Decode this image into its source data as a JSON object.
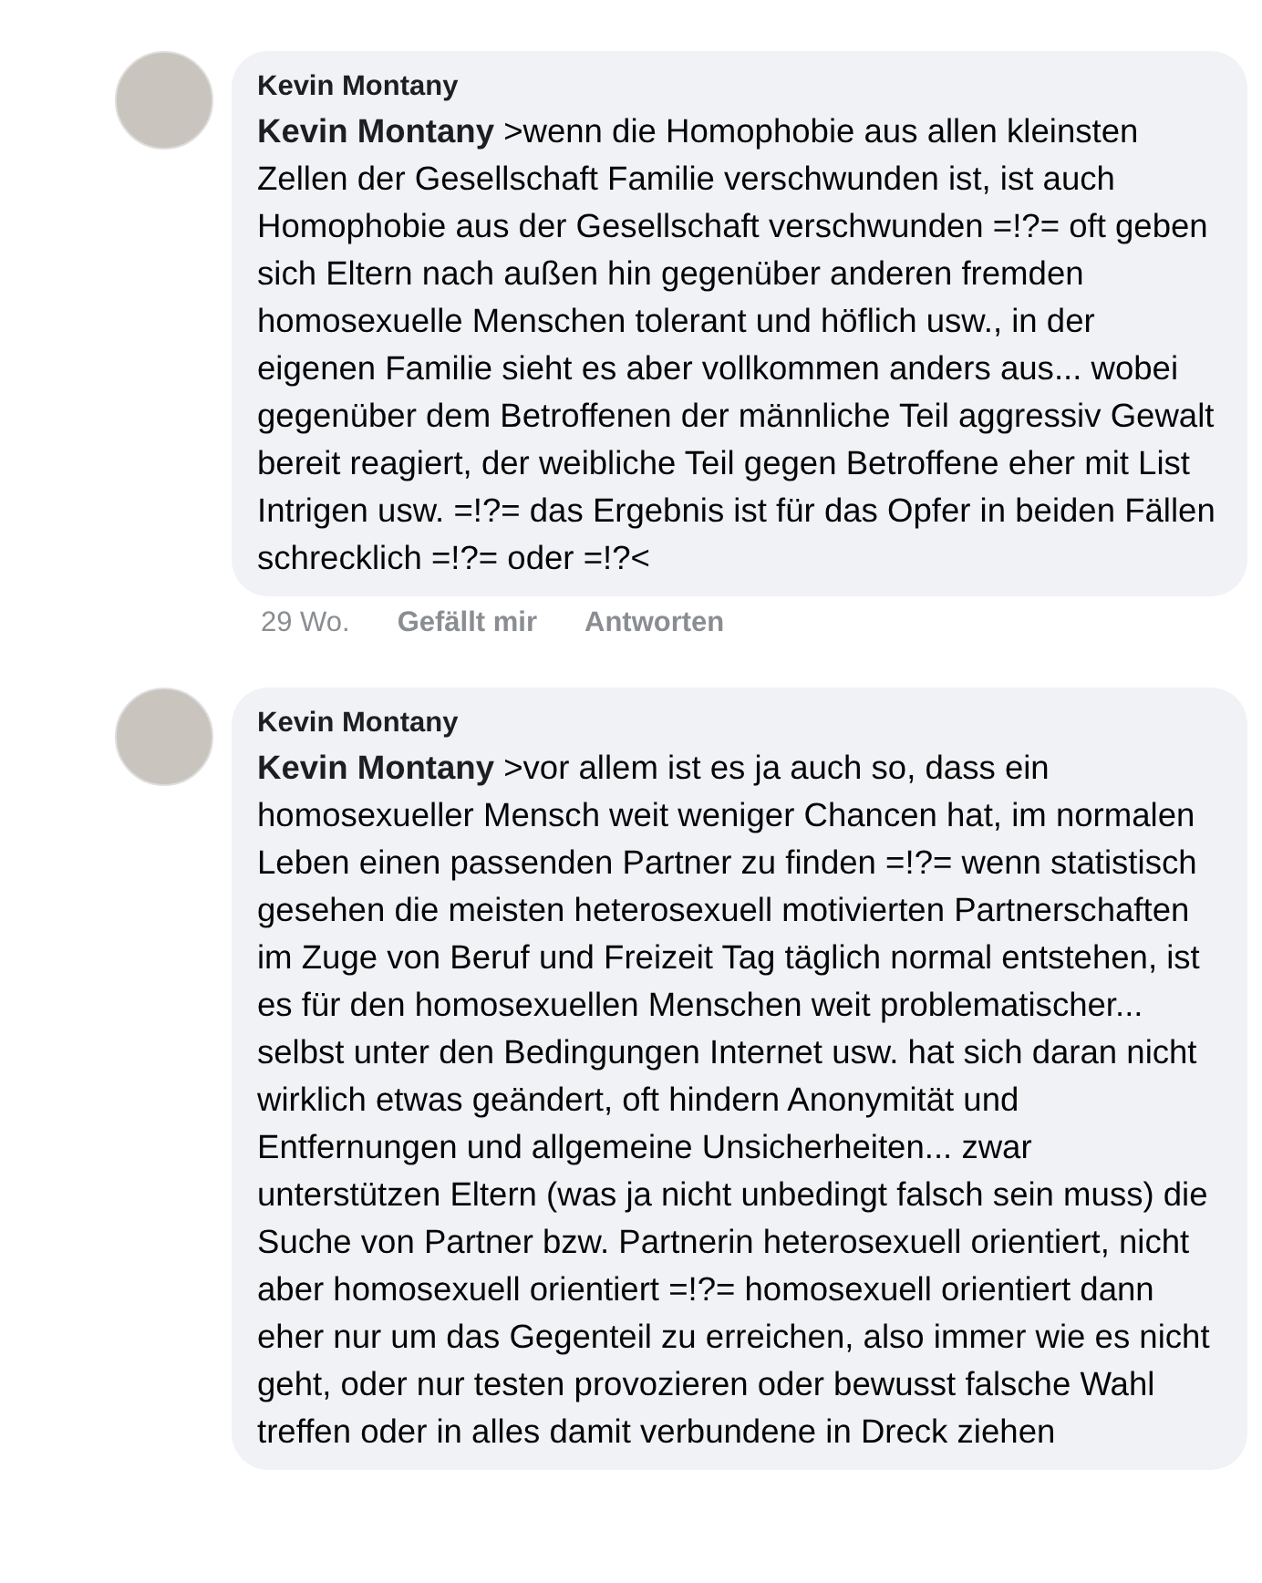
{
  "comments": [
    {
      "author": "Kevin Montany",
      "text": "**Kevin Montany** >wenn die Homophobie aus allen kleinsten Zellen der Gesellschaft Familie verschwunden ist, ist auch Homophobie aus der Gesellschaft verschwunden =!?= oft geben sich Eltern nach außen hin gegenüber anderen fremden homosexuelle Menschen tolerant und höflich usw., in der eigenen Familie sieht es aber vollkommen anders aus... wobei  gegenüber dem Betroffenen der männliche Teil aggressiv Gewalt bereit reagiert, der weibliche Teil gegen Betroffene eher mit List Intrigen usw. =!?= das Ergebnis ist für das Opfer in beiden Fällen schrecklich =!?= oder =!?<",
      "time": "29 Wo.",
      "like": "Gefällt mir",
      "reply": "Antworten"
    },
    {
      "author": "Kevin Montany",
      "text": "**Kevin Montany** >vor allem ist es ja auch so, dass ein homosexueller Mensch weit weniger Chancen hat, im normalen Leben einen passenden Partner zu finden =!?= wenn statistisch gesehen die meisten heterosexuell motivierten Partnerschaften im Zuge von Beruf und Freizeit Tag täglich normal entstehen, ist es für den homosexuellen Menschen weit problematischer... selbst unter den Bedingungen Internet usw. hat sich daran nicht wirklich etwas geändert, oft hindern Anonymität und Entfernungen und allgemeine Unsicherheiten... zwar unterstützen Eltern (was ja nicht unbedingt falsch sein muss) die Suche von Partner bzw. Partnerin heterosexuell orientiert, nicht aber homosexuell orientiert =!?= homosexuell orientiert dann eher nur um das Gegenteil zu erreichen, also immer wie es nicht geht, oder nur testen provozieren oder bewusst falsche Wahl treffen oder in alles damit verbundene in Dreck ziehen"
    }
  ]
}
